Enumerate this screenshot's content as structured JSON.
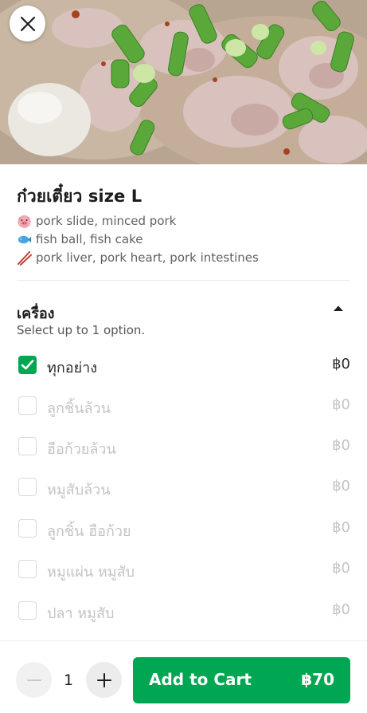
{
  "item": {
    "title": "ก๋วยเตี๋ยว size L",
    "description": [
      {
        "icon": "pig-icon",
        "text": "pork slide, minced pork"
      },
      {
        "icon": "fish-icon",
        "text": "fish ball, fish cake"
      },
      {
        "icon": "chopsticks-icon",
        "text": "pork liver, pork heart, pork intestines"
      }
    ]
  },
  "section": {
    "title": "เครื่อง",
    "subtitle": "Select up to 1 option.",
    "options": [
      {
        "label": "ทุกอย่าง",
        "price": "฿0",
        "checked": true
      },
      {
        "label": "ลูกชิ้นล้วน",
        "price": "฿0",
        "checked": false
      },
      {
        "label": "ฮือก้วยล้วน",
        "price": "฿0",
        "checked": false
      },
      {
        "label": "หมูสับล้วน",
        "price": "฿0",
        "checked": false
      },
      {
        "label": "ลูกชิ้น ฮือก้วย",
        "price": "฿0",
        "checked": false
      },
      {
        "label": "หมูแผ่น หมูสับ",
        "price": "฿0",
        "checked": false
      },
      {
        "label": "ปลา หมูสับ",
        "price": "฿0",
        "checked": false
      }
    ]
  },
  "footer": {
    "quantity": "1",
    "add_label": "Add to Cart",
    "add_price": "฿70"
  },
  "colors": {
    "accent": "#00a651",
    "disabled_text": "#c4c4c4"
  },
  "icons": {
    "close": "close-icon",
    "collapse": "chevron-up-icon",
    "minus": "minus-icon",
    "plus": "plus-icon",
    "check": "check-icon"
  }
}
